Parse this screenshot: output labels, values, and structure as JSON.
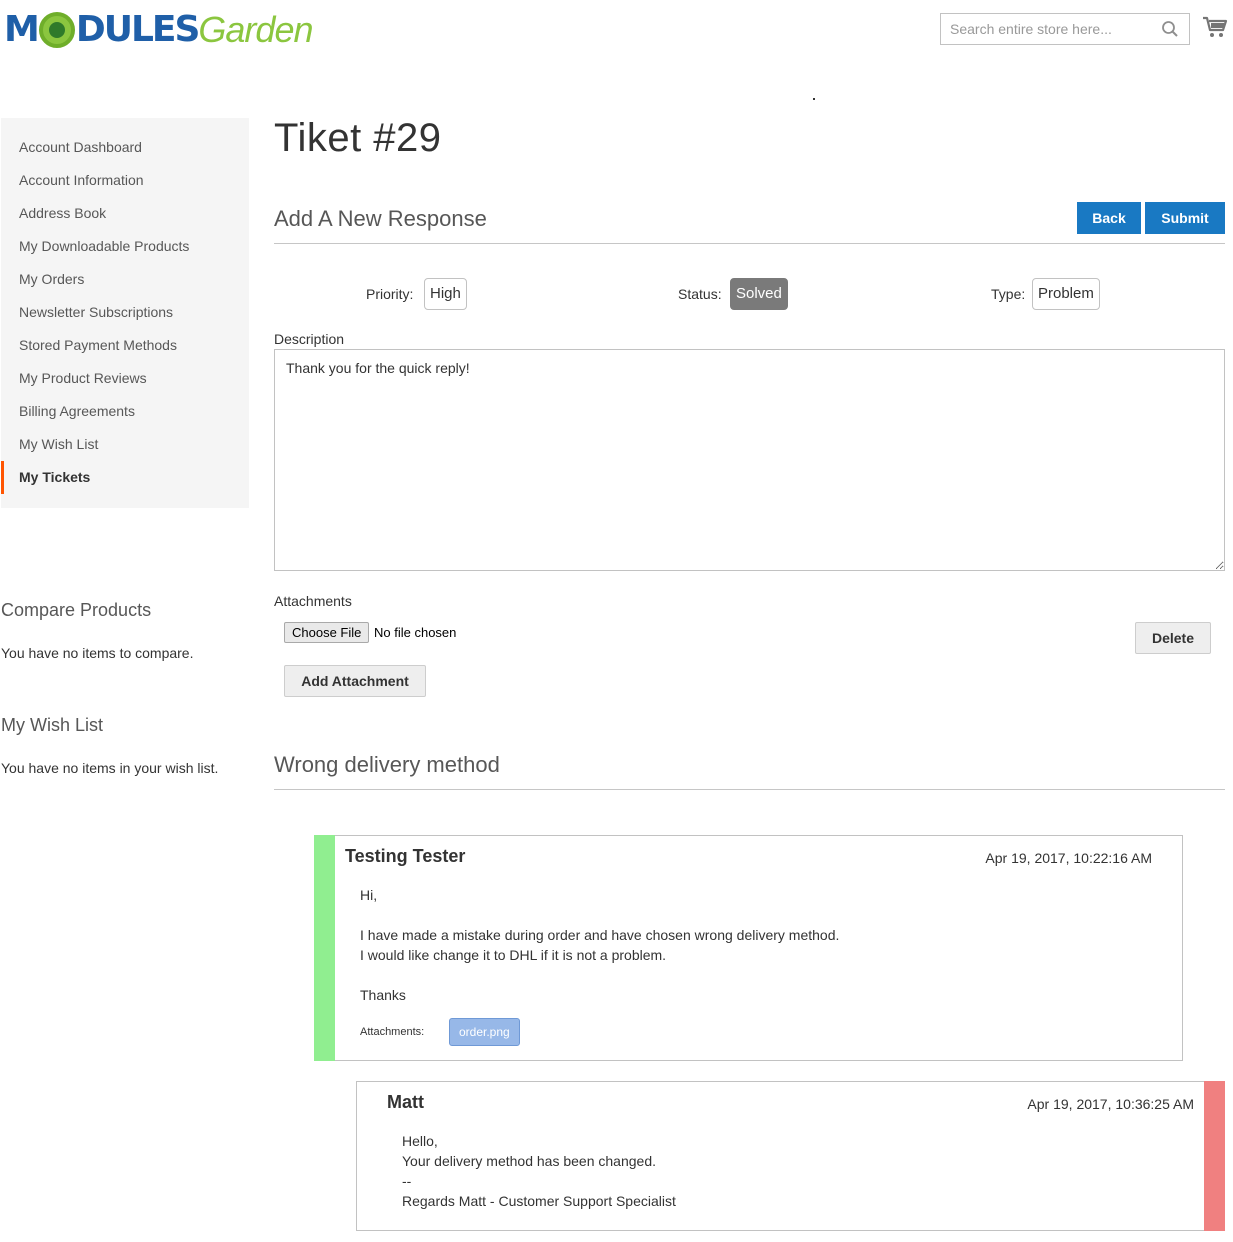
{
  "header": {
    "logo_part1": "M",
    "logo_part2": "DULES",
    "logo_part3": "Garden",
    "search_placeholder": "Search entire store here...",
    "icons": {
      "search": "search-icon",
      "cart": "cart-icon"
    }
  },
  "sidebar": {
    "items": [
      {
        "label": "Account Dashboard",
        "active": false
      },
      {
        "label": "Account Information",
        "active": false
      },
      {
        "label": "Address Book",
        "active": false
      },
      {
        "label": "My Downloadable Products",
        "active": false
      },
      {
        "label": "My Orders",
        "active": false
      },
      {
        "label": "Newsletter Subscriptions",
        "active": false
      },
      {
        "label": "Stored Payment Methods",
        "active": false
      },
      {
        "label": "My Product Reviews",
        "active": false
      },
      {
        "label": "Billing Agreements",
        "active": false
      },
      {
        "label": "My Wish List",
        "active": false
      },
      {
        "label": "My Tickets",
        "active": true
      }
    ],
    "active_accent": "#ff5501"
  },
  "compare": {
    "title": "Compare Products",
    "empty_text": "You have no items to compare."
  },
  "wishlist": {
    "title": "My Wish List",
    "empty_text": "You have no items in your wish list."
  },
  "ticket": {
    "title": "Tiket #29",
    "response_heading": "Add A New Response",
    "back_label": "Back",
    "submit_label": "Submit",
    "priority_label": "Priority:",
    "priority_value": "High",
    "status_label": "Status:",
    "status_value": "Solved",
    "type_label": "Type:",
    "type_value": "Problem",
    "description_label": "Description",
    "description_value": "Thank you for the quick reply!",
    "attachments_label": "Attachments",
    "choose_file_label": "Choose File",
    "no_file_text": "No file chosen",
    "delete_label": "Delete",
    "add_attachment_label": "Add Attachment",
    "subject": "Wrong delivery method"
  },
  "messages": [
    {
      "author": "Testing Tester",
      "date": "Apr 19, 2017, 10:22:16 AM",
      "lines": [
        "Hi,",
        "",
        "I have made a mistake during order and have chosen wrong delivery method.",
        "I would like change it to DHL if it is not a problem.",
        "",
        "Thanks"
      ],
      "attachments_label": "Attachments:",
      "attachment": "order.png",
      "accent": "#90ee90"
    },
    {
      "author": "Matt",
      "date": "Apr 19, 2017, 10:36:25 AM",
      "lines": [
        "Hello,",
        "Your delivery method has been changed.",
        "--",
        "Regards Matt - Customer Support Specialist"
      ],
      "accent": "#f08080"
    }
  ],
  "colors": {
    "primary": "#1979c3",
    "status_solved": "#7a7a7a",
    "attachment_chip": "#97b8e8"
  }
}
